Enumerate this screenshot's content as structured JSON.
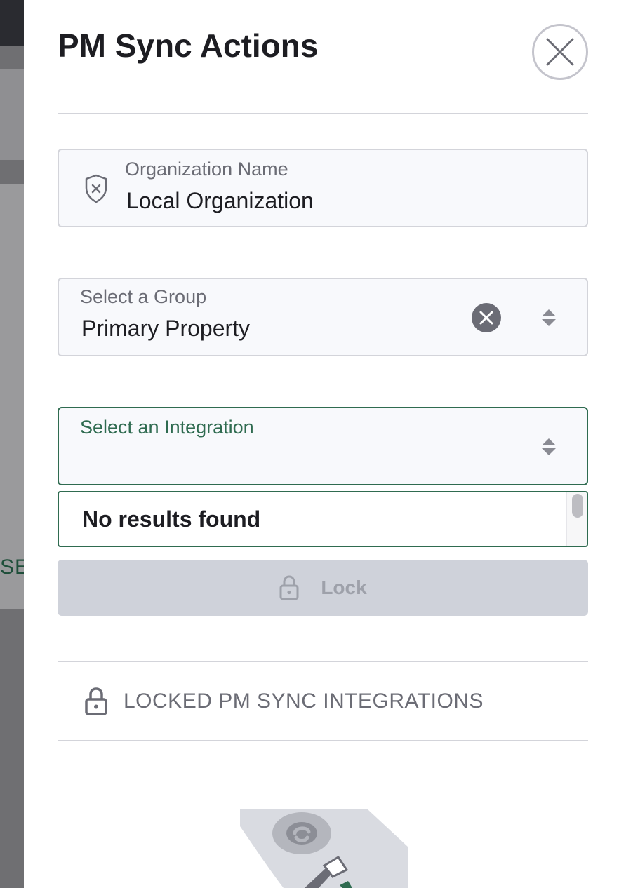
{
  "background": {
    "partial_text": "SE"
  },
  "drawer": {
    "title": "PM Sync Actions",
    "close_icon": "close-icon"
  },
  "organization": {
    "label": "Organization Name",
    "value": "Local Organization",
    "icon": "shield-x-icon"
  },
  "group_select": {
    "label": "Select a Group",
    "value": "Primary Property",
    "clear_icon": "clear-circle-icon",
    "sort_icon": "sort-arrows-icon"
  },
  "integration_select": {
    "label": "Select an Integration",
    "value": "",
    "sort_icon": "sort-arrows-icon",
    "dropdown_empty_text": "No results found"
  },
  "lock_button": {
    "label": "Lock",
    "icon": "lock-icon",
    "disabled": true
  },
  "locked_section": {
    "title": "LOCKED PM SYNC INTEGRATIONS",
    "icon": "lock-icon"
  },
  "colors": {
    "accent_green": "#2f6b50",
    "muted_text": "#6b6c75",
    "disabled_button": "#cfd2da"
  }
}
